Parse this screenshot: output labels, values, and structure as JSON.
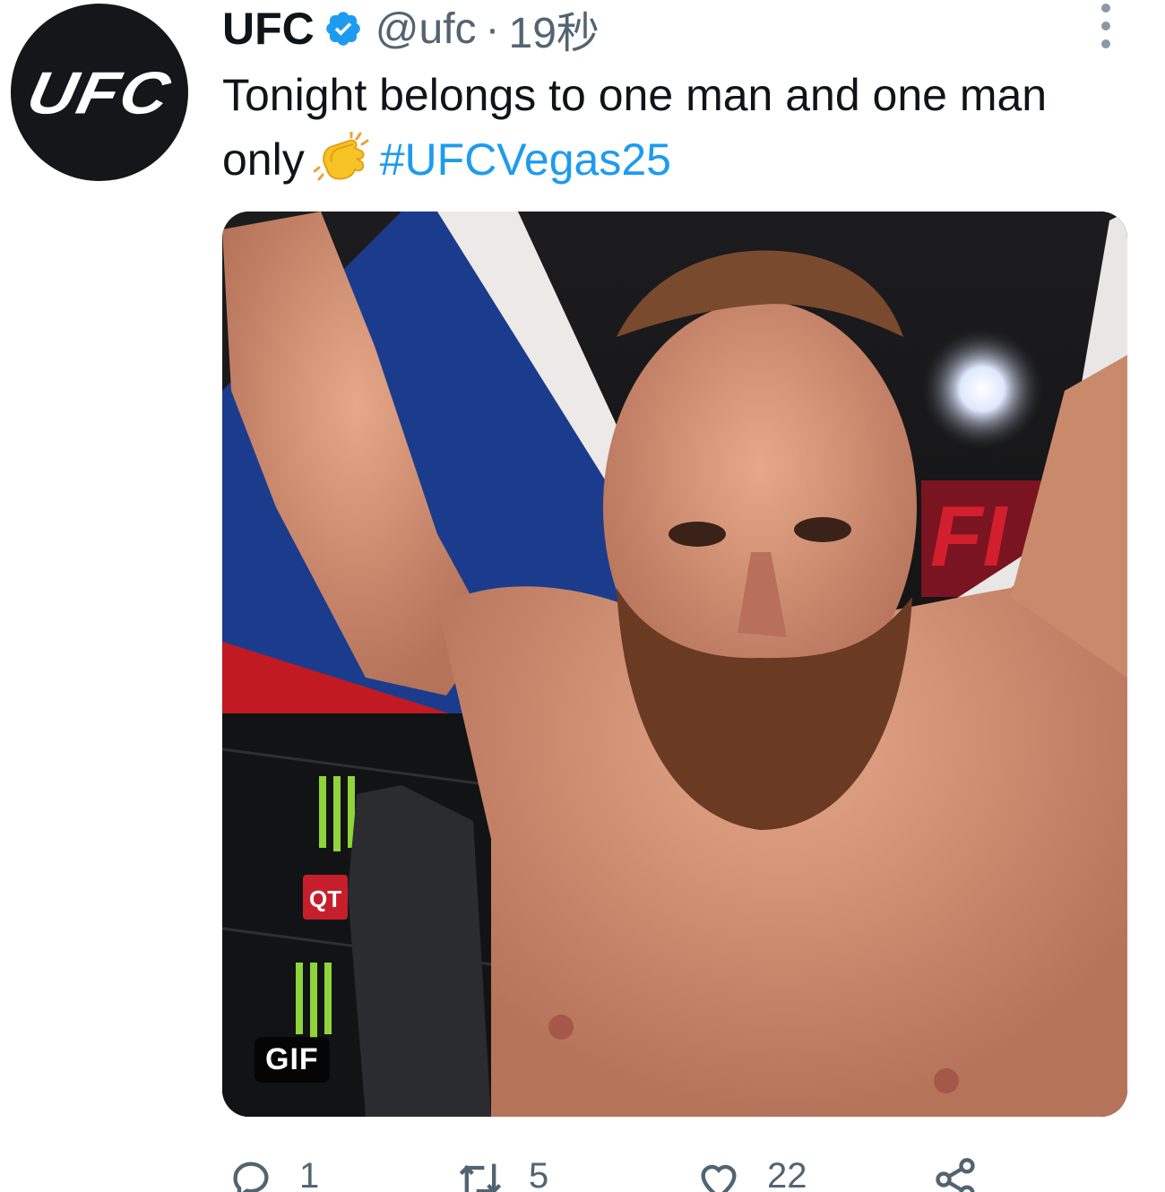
{
  "author": {
    "display_name": "UFC",
    "handle": "@ufc",
    "separator": "·",
    "time": "19秒",
    "avatar_text": "UFC",
    "verified_icon": "verified-badge-icon"
  },
  "tweet": {
    "text_before": "Tonight belongs to one man and one man only",
    "emoji": "clapping-hands",
    "hashtag": "#UFCVegas25"
  },
  "media": {
    "badge": "GIF",
    "description_icon": "gif-media"
  },
  "actions": {
    "reply_count": "1",
    "retweet_count": "5",
    "like_count": "22"
  },
  "colors": {
    "link": "#1d9bf0",
    "muted": "#536471",
    "avatar_bg": "#15161a"
  }
}
